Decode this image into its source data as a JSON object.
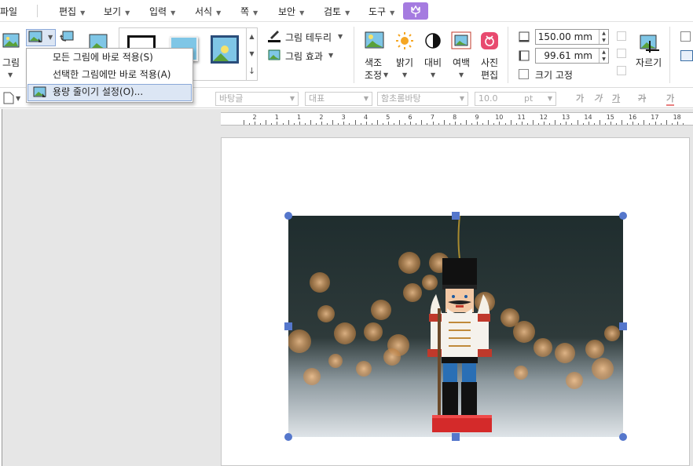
{
  "menubar": {
    "items": [
      {
        "label": "파일",
        "arrow": false
      },
      {
        "label": "편집",
        "arrow": true
      },
      {
        "label": "보기",
        "arrow": true
      },
      {
        "label": "입력",
        "arrow": true
      },
      {
        "label": "서식",
        "arrow": true
      },
      {
        "label": "쪽",
        "arrow": true
      },
      {
        "label": "보안",
        "arrow": true
      },
      {
        "label": "검토",
        "arrow": true
      },
      {
        "label": "도구",
        "arrow": true
      }
    ],
    "help_icon": "tulip-icon"
  },
  "ribbon": {
    "picture_label": "그림",
    "border_label": "그림 테두리",
    "effect_label": "그림 효과",
    "color_tone_label_1": "색조",
    "color_tone_label_2": "조정",
    "brightness_label": "밝기",
    "contrast_label": "대비",
    "margin_label": "여백",
    "photo_edit_label_1": "사진",
    "photo_edit_label_2": "편집",
    "width_value": "150.00",
    "width_unit": "mm",
    "height_value": "99.61",
    "height_unit": "mm",
    "lock_size_label": "크기 고정",
    "crop_label": "자르기"
  },
  "dropdown": {
    "items": [
      {
        "label": "모든 그림에 바로 적용(S)",
        "highlighted": false
      },
      {
        "label": "선택한 그림에만 바로 적용(A)",
        "highlighted": false
      },
      {
        "label": "용량 줄이기 설정(O)...",
        "highlighted": true
      }
    ]
  },
  "toolbar2": {
    "style_value": "바탕글",
    "outline_value": "대표",
    "font_value": "함초롬바탕",
    "size_value": "10.0",
    "size_unit": "pt",
    "bold_glyph": "가",
    "italic_glyph": "가",
    "underline_glyph": "가",
    "strike_glyph": "가",
    "color_glyph": "가"
  },
  "ruler": {
    "labels": [
      "2",
      "1",
      "1",
      "2",
      "3",
      "4",
      "5",
      "6",
      "7",
      "8",
      "9",
      "10",
      "11",
      "12",
      "13",
      "14",
      "15",
      "16",
      "17",
      "18"
    ]
  },
  "colors": {
    "accent": "#a57be0",
    "handle": "#5577cc",
    "highlight_bg": "#dce6f4",
    "highlight_border": "#8aa8d8"
  },
  "document": {
    "image_icon": "nutcracker-photo"
  }
}
